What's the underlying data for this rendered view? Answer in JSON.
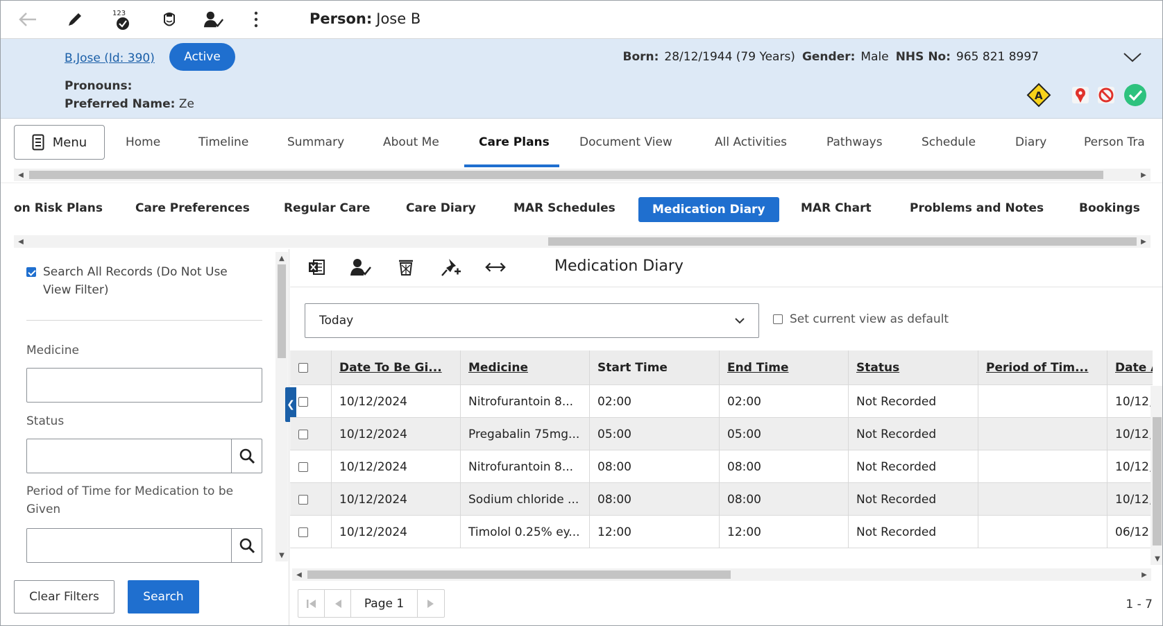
{
  "header": {
    "person_label": "Person:",
    "person_name": "Jose B"
  },
  "banner": {
    "person_link": "B,Jose (Id: 390)",
    "status": "Active",
    "pronouns_label": "Pronouns:",
    "preferred_name_label": "Preferred Name:",
    "preferred_name": "Ze",
    "born_label": "Born:",
    "born": "28/12/1944 (79 Years)",
    "gender_label": "Gender:",
    "gender": "Male",
    "nhs_label": "NHS No:",
    "nhs": "965 821 8997"
  },
  "main_tabs": {
    "menu_label": "Menu",
    "items": [
      "Home",
      "Timeline",
      "Summary",
      "About Me",
      "Care Plans",
      "Document View",
      "All Activities",
      "Pathways",
      "Schedule",
      "Diary",
      "Person Tra"
    ],
    "active": "Care Plans"
  },
  "sub_tabs": {
    "items": [
      "on Risk Plans",
      "Care Preferences",
      "Regular Care",
      "Care Diary",
      "MAR Schedules",
      "Medication Diary",
      "MAR Chart",
      "Problems and Notes",
      "Bookings"
    ],
    "active": "Medication Diary"
  },
  "filters": {
    "search_all_label": "Search All Records (Do Not Use View Filter)",
    "search_all_checked": true,
    "medicine_label": "Medicine",
    "medicine_value": "",
    "status_label": "Status",
    "status_value": "",
    "period_label": "Period of Time for Medication to be Given",
    "period_value": "",
    "clear_label": "Clear Filters",
    "search_label": "Search"
  },
  "content": {
    "title": "Medication Diary",
    "view_select": "Today",
    "default_view_label": "Set current view as default"
  },
  "grid": {
    "columns": [
      "Date To Be Gi...",
      "Medicine",
      "Start Time",
      "End Time",
      "Status",
      "Period of Tim...",
      "Date A"
    ],
    "rows": [
      [
        "10/12/2024",
        "Nitrofurantoin 8...",
        "02:00",
        "02:00",
        "Not Recorded",
        "",
        "10/12,"
      ],
      [
        "10/12/2024",
        "Pregabalin 75mg...",
        "05:00",
        "05:00",
        "Not Recorded",
        "",
        "10/12,"
      ],
      [
        "10/12/2024",
        "Nitrofurantoin 8...",
        "08:00",
        "08:00",
        "Not Recorded",
        "",
        "10/12,"
      ],
      [
        "10/12/2024",
        "Sodium chloride ...",
        "08:00",
        "08:00",
        "Not Recorded",
        "",
        "10/12,"
      ],
      [
        "10/12/2024",
        "Timolol 0.25% ey...",
        "12:00",
        "12:00",
        "Not Recorded",
        "",
        "06/12"
      ]
    ]
  },
  "pager": {
    "page_label": "Page 1",
    "count": "1 - 7"
  },
  "colors": {
    "accent": "#1f6fcf",
    "banner_bg": "#dde9f6",
    "link": "#1a5fa8"
  },
  "icons": {
    "toolbar": [
      "back-arrow-icon",
      "pencil-icon",
      "numbered-badge-icon",
      "nurse-icon",
      "person-check-icon",
      "more-vertical-icon"
    ],
    "alerts": [
      "allergy-warning-icon",
      "location-pin-icon",
      "no-entry-icon",
      "verified-check-icon"
    ],
    "content_toolbar": [
      "excel-export-icon",
      "person-check-icon",
      "delete-bin-icon",
      "pin-add-icon",
      "expand-horizontal-icon"
    ]
  }
}
